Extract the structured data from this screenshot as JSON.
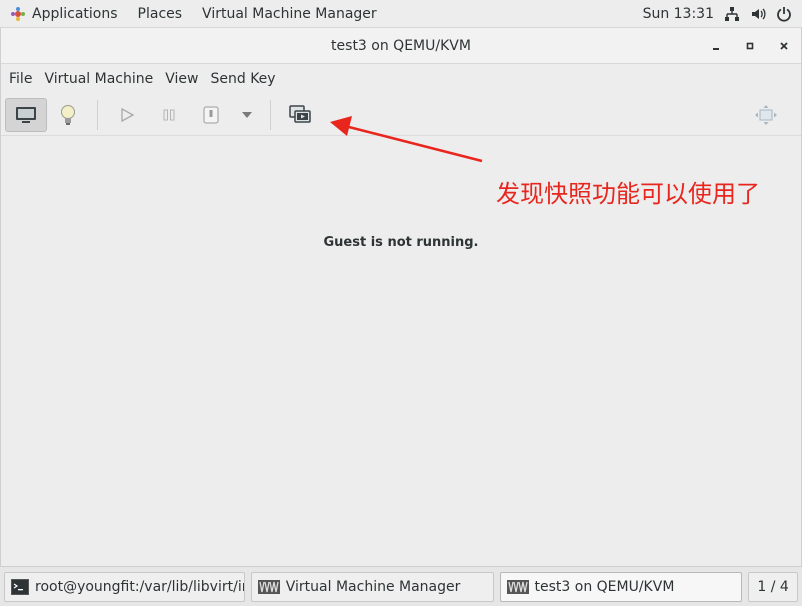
{
  "topbar": {
    "applications": "Applications",
    "places": "Places",
    "app_name": "Virtual Machine Manager",
    "clock": "Sun 13:31"
  },
  "window": {
    "title": "test3 on QEMU/KVM",
    "menu": [
      "File",
      "Virtual Machine",
      "View",
      "Send Key"
    ]
  },
  "content": {
    "status": "Guest is not running."
  },
  "annotation": {
    "text": "发现快照功能可以使用了",
    "color": "#e8261e"
  },
  "taskbar": {
    "tasks": [
      {
        "label": "root@youngfit:/var/lib/libvirt/ima..."
      },
      {
        "label": "Virtual Machine Manager"
      },
      {
        "label": "test3 on QEMU/KVM"
      }
    ],
    "workspace": "1 / 4"
  },
  "icons": {
    "toolbar": [
      "console-icon",
      "details-lightbulb-icon",
      "run-icon",
      "pause-icon",
      "shutdown-icon",
      "dropdown-arrow-icon",
      "snapshots-icon",
      "fullscreen-icon"
    ],
    "tray": [
      "network-icon",
      "volume-icon",
      "power-icon"
    ]
  }
}
